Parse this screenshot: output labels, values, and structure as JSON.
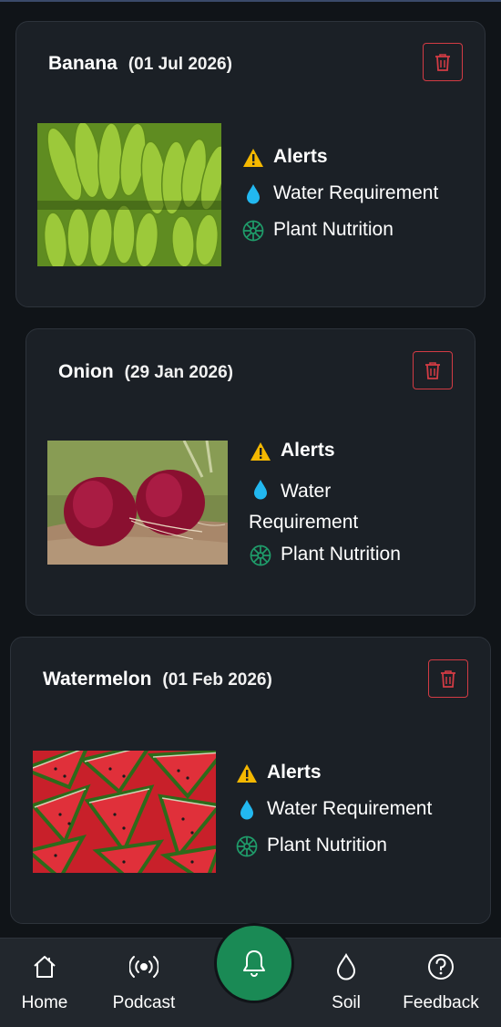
{
  "crops": [
    {
      "name": "Banana",
      "date": "(01 Jul 2026)",
      "image": "banana-photo",
      "menu": {
        "alerts": "Alerts",
        "water": "Water Requirement",
        "nutrition": "Plant Nutrition"
      }
    },
    {
      "name": "Onion",
      "date": "(29 Jan 2026)",
      "image": "onion-photo",
      "menu": {
        "alerts": "Alerts",
        "water": "Water Requirement",
        "nutrition": "Plant Nutrition"
      }
    },
    {
      "name": "Watermelon",
      "date": "(01 Feb 2026)",
      "image": "watermelon-photo",
      "menu": {
        "alerts": "Alerts",
        "water": "Water Requirement",
        "nutrition": "Plant Nutrition"
      }
    }
  ],
  "nav": {
    "home": "Home",
    "podcast": "Podcast",
    "soil": "Soil",
    "feedback": "Feedback"
  },
  "icons": {
    "delete": "trash-icon",
    "alerts": "warning-icon",
    "water": "water-drop-icon",
    "nutrition": "nutrition-flower-icon",
    "home": "home-icon",
    "podcast": "podcast-icon",
    "notifications": "bell-icon",
    "soil": "soil-drop-icon",
    "feedback": "help-icon"
  },
  "colors": {
    "background": "#101418",
    "card": "#1b2026",
    "delete_accent": "#d23b44",
    "alert_icon": "#f5b800",
    "water_icon": "#22b8f0",
    "nutrition_icon": "#1f9c6a",
    "fab": "#1a8a55"
  }
}
